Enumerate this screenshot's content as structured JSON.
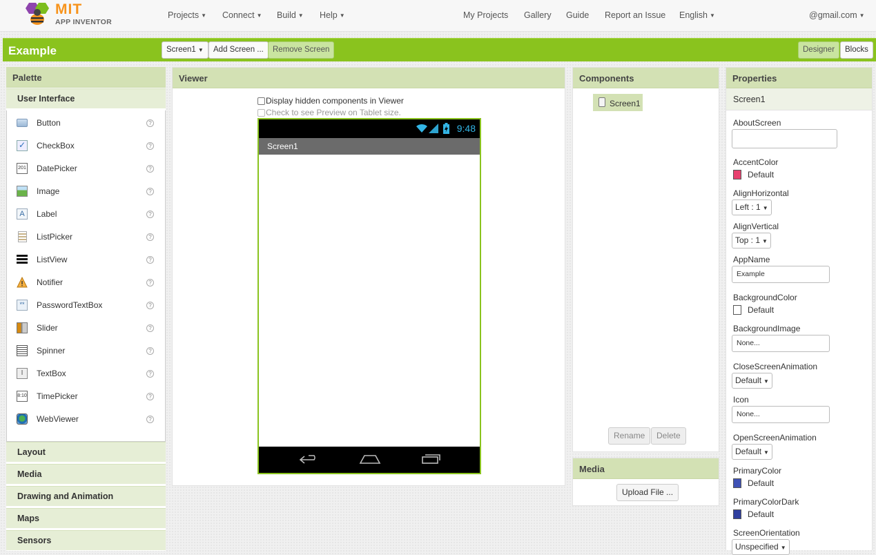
{
  "nav": {
    "logo_mit": "MIT",
    "logo_sub": "APP INVENTOR",
    "menus": [
      "Projects",
      "Connect",
      "Build",
      "Help"
    ],
    "links": [
      "My Projects",
      "Gallery",
      "Guide",
      "Report an Issue"
    ],
    "language": "English",
    "account": "@gmail.com"
  },
  "toolbar": {
    "project_name": "Example",
    "screen_select": "Screen1",
    "add_screen": "Add Screen ...",
    "remove_screen": "Remove Screen",
    "designer": "Designer",
    "blocks": "Blocks"
  },
  "palette": {
    "title": "Palette",
    "open_category": "User Interface",
    "items": [
      {
        "label": "Button",
        "icon": "button-icon"
      },
      {
        "label": "CheckBox",
        "icon": "checkbox-icon"
      },
      {
        "label": "DatePicker",
        "icon": "calendar-icon"
      },
      {
        "label": "Image",
        "icon": "image-icon"
      },
      {
        "label": "Label",
        "icon": "label-icon"
      },
      {
        "label": "ListPicker",
        "icon": "listpicker-icon"
      },
      {
        "label": "ListView",
        "icon": "listview-icon"
      },
      {
        "label": "Notifier",
        "icon": "warning-icon"
      },
      {
        "label": "PasswordTextBox",
        "icon": "password-icon"
      },
      {
        "label": "Slider",
        "icon": "slider-icon"
      },
      {
        "label": "Spinner",
        "icon": "spinner-icon"
      },
      {
        "label": "TextBox",
        "icon": "textbox-icon"
      },
      {
        "label": "TimePicker",
        "icon": "clock-icon"
      },
      {
        "label": "WebViewer",
        "icon": "globe-icon"
      }
    ],
    "help_glyph": "?",
    "categories": [
      "Layout",
      "Media",
      "Drawing and Animation",
      "Maps",
      "Sensors"
    ]
  },
  "viewer": {
    "title": "Viewer",
    "hidden_label": "Display hidden components in Viewer",
    "tablet_label": "Check to see Preview on Tablet size.",
    "phone_time": "9:48",
    "phone_title": "Screen1"
  },
  "components": {
    "title": "Components",
    "tree_item": "Screen1",
    "rename": "Rename",
    "delete": "Delete"
  },
  "media": {
    "title": "Media",
    "upload": "Upload File ..."
  },
  "properties": {
    "title": "Properties",
    "selected": "Screen1",
    "about_screen": {
      "label": "AboutScreen",
      "value": ""
    },
    "accent_color": {
      "label": "AccentColor",
      "value": "Default",
      "color": "#e8416f"
    },
    "align_horizontal": {
      "label": "AlignHorizontal",
      "value": "Left : 1"
    },
    "align_vertical": {
      "label": "AlignVertical",
      "value": "Top : 1"
    },
    "app_name": {
      "label": "AppName",
      "value": "Example"
    },
    "background_color": {
      "label": "BackgroundColor",
      "value": "Default",
      "color": "#ffffff"
    },
    "background_image": {
      "label": "BackgroundImage",
      "value": "None..."
    },
    "close_anim": {
      "label": "CloseScreenAnimation",
      "value": "Default"
    },
    "icon": {
      "label": "Icon",
      "value": "None..."
    },
    "open_anim": {
      "label": "OpenScreenAnimation",
      "value": "Default"
    },
    "primary_color": {
      "label": "PrimaryColor",
      "value": "Default",
      "color": "#3f51b5"
    },
    "primary_color_dark": {
      "label": "PrimaryColorDark",
      "value": "Default",
      "color": "#303f9f"
    },
    "screen_orientation": {
      "label": "ScreenOrientation",
      "value": "Unspecified"
    }
  }
}
